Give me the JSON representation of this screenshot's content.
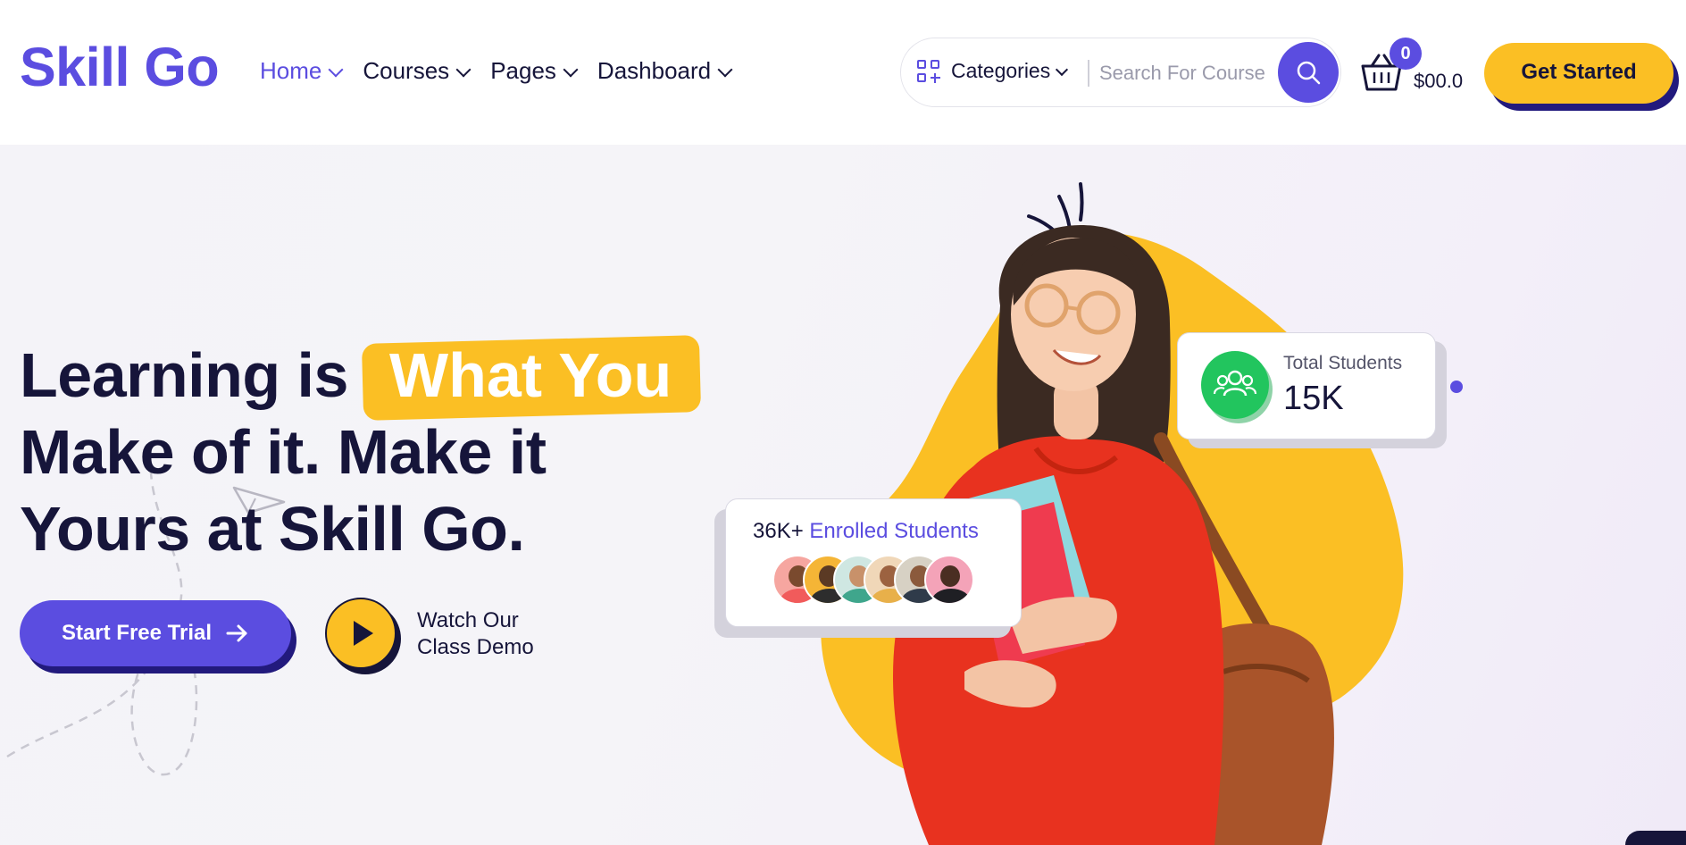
{
  "header": {
    "logo": "Skill Go",
    "nav": [
      {
        "label": "Home",
        "active": true
      },
      {
        "label": "Courses",
        "active": false
      },
      {
        "label": "Pages",
        "active": false
      },
      {
        "label": "Dashboard",
        "active": false
      }
    ],
    "categories_label": "Categories",
    "search_placeholder": "Search For Course",
    "cart_count": "0",
    "cart_total": "$00.0",
    "cta_label": "Get Started"
  },
  "hero": {
    "line1_start": "Learning is",
    "line1_highlight": "What You",
    "line2": "Make of it. Make it",
    "line3": "Yours at Skill Go.",
    "primary_button": "Start Free Trial",
    "watch_line1": "Watch Our",
    "watch_line2": "Class Demo"
  },
  "stats": {
    "total_students_label": "Total Students",
    "total_students_value": "15K",
    "enrolled_count": "36K+",
    "enrolled_label": "Enrolled Students"
  },
  "colors": {
    "primary": "#5b4de0",
    "accent": "#fbbf24",
    "dark": "#16153a",
    "success": "#22c55e"
  }
}
